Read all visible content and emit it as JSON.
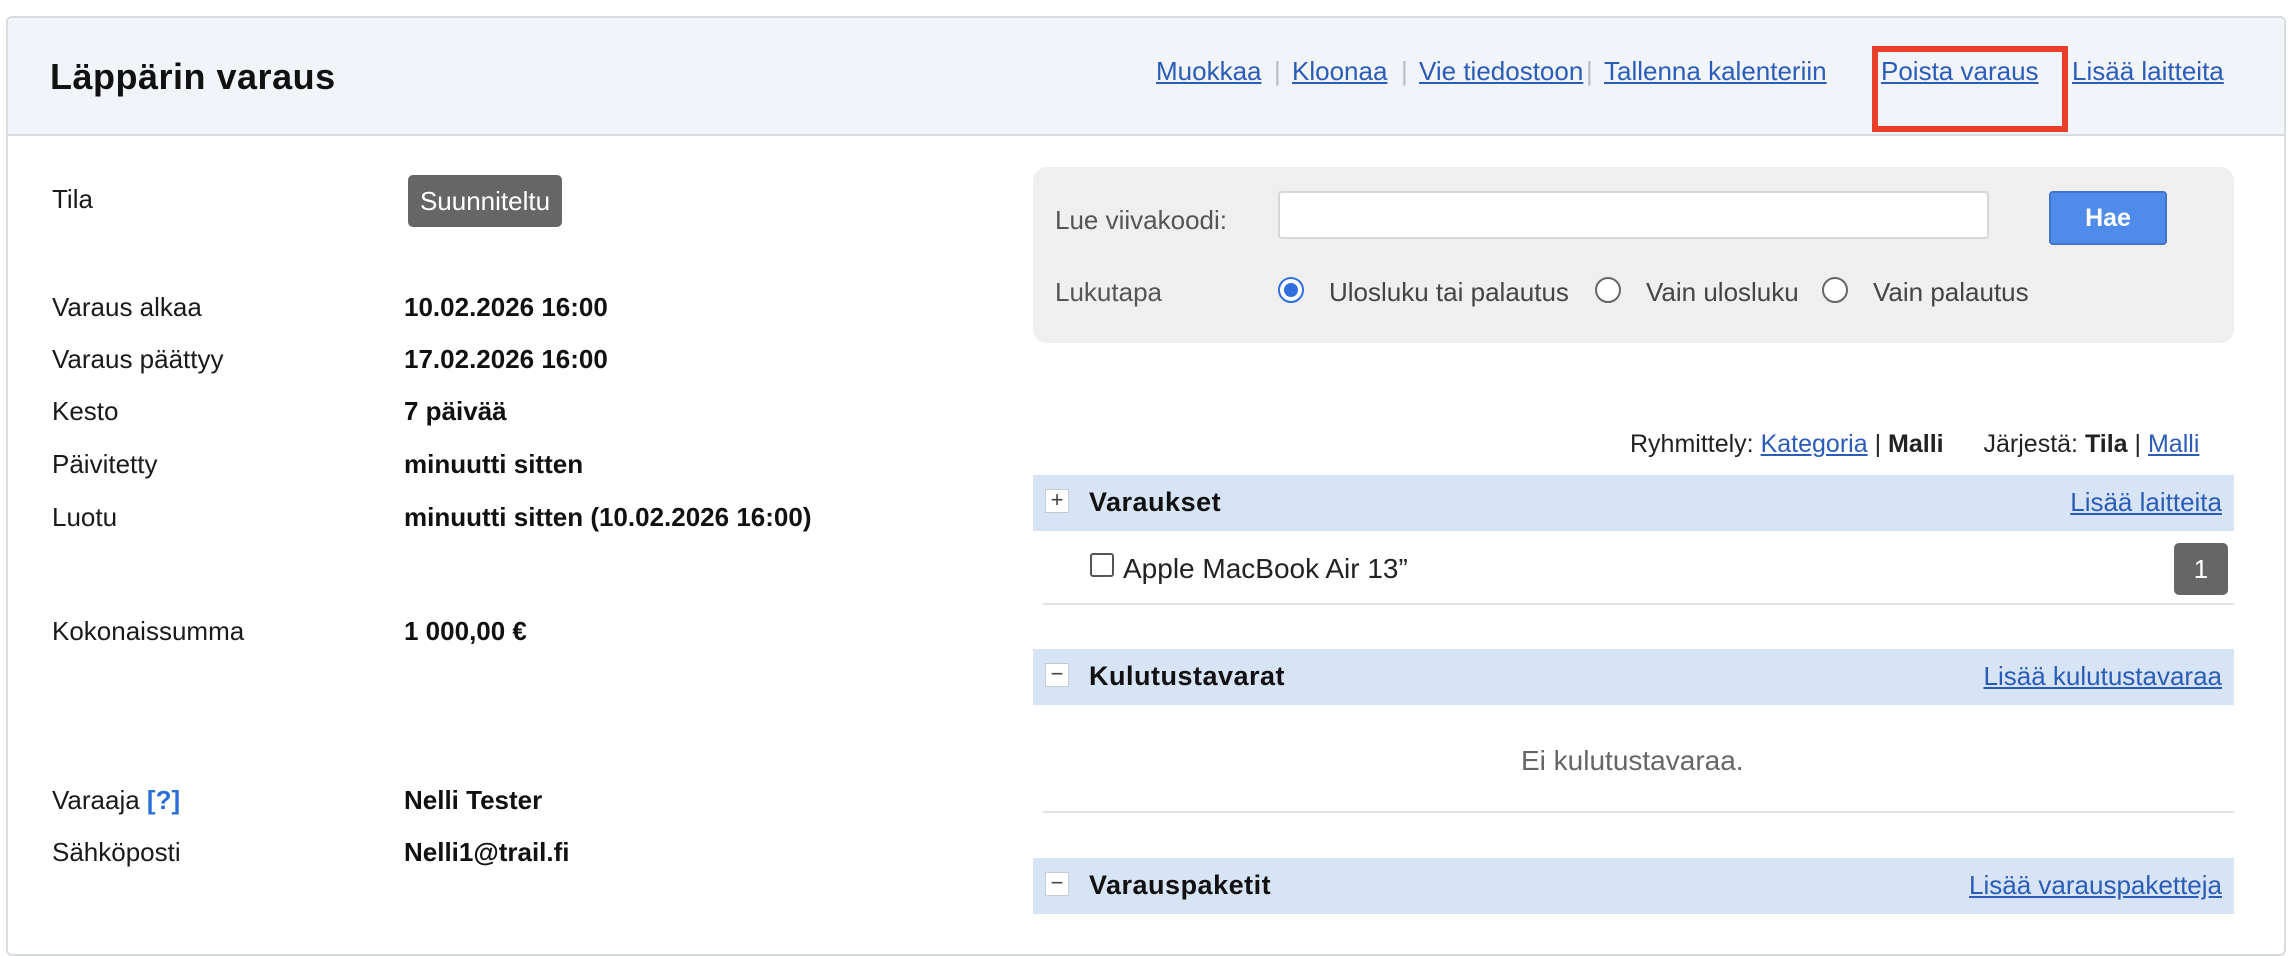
{
  "header": {
    "title": "Läppärin varaus",
    "actions": {
      "edit": "Muokkaa",
      "clone": "Kloonaa",
      "export": "Vie tiedostoon",
      "calendar": "Tallenna kalenteriin",
      "delete": "Poista varaus",
      "add_devices": "Lisää laitteita"
    },
    "separator": "|",
    "highlight_color": "#e8402a"
  },
  "details": {
    "status_label": "Tila",
    "status_value": "Suunniteltu",
    "start_label": "Varaus alkaa",
    "start_value": "10.02.2026 16:00",
    "end_label": "Varaus päättyy",
    "end_value": "17.02.2026 16:00",
    "duration_label": "Kesto",
    "duration_value": "7 päivää",
    "updated_label": "Päivitetty",
    "updated_value": "minuutti sitten",
    "created_label": "Luotu",
    "created_value": "minuutti sitten (10.02.2026 16:00)",
    "total_label": "Kokonaissumma",
    "total_value": "1 000,00 €",
    "reserver_label": "Varaaja",
    "reserver_help": "[?]",
    "reserver_value": "Nelli Tester",
    "email_label": "Sähköposti",
    "email_value": "Nelli1@trail.fi"
  },
  "scan": {
    "barcode_label": "Lue viivakoodi:",
    "barcode_value": "",
    "search_button": "Hae",
    "mode_label": "Lukutapa",
    "modes": [
      "Ulosluku tai palautus",
      "Vain ulosluku",
      "Vain palautus"
    ],
    "selected_mode": "Ulosluku tai palautus",
    "accent_color": "#4f8bea"
  },
  "grouping": {
    "group_label": "Ryhmittely:",
    "group_category": "Kategoria",
    "group_sep": "|",
    "group_model": "Malli",
    "sort_label": "Järjestä:",
    "sort_status": "Tila",
    "sort_sep": "|",
    "sort_model": "Malli"
  },
  "sections": {
    "reservations": {
      "toggle": "+",
      "title": "Varaukset",
      "link": "Lisää laitteita",
      "items": [
        {
          "name": "Apple MacBook Air 13”",
          "count": "1"
        }
      ]
    },
    "consumables": {
      "toggle": "−",
      "title": "Kulutustavarat",
      "link": "Lisää kulutustavaraa",
      "empty": "Ei kulutustavaraa."
    },
    "packages": {
      "toggle": "−",
      "title": "Varauspaketit",
      "link": "Lisää varauspaketteja"
    }
  }
}
